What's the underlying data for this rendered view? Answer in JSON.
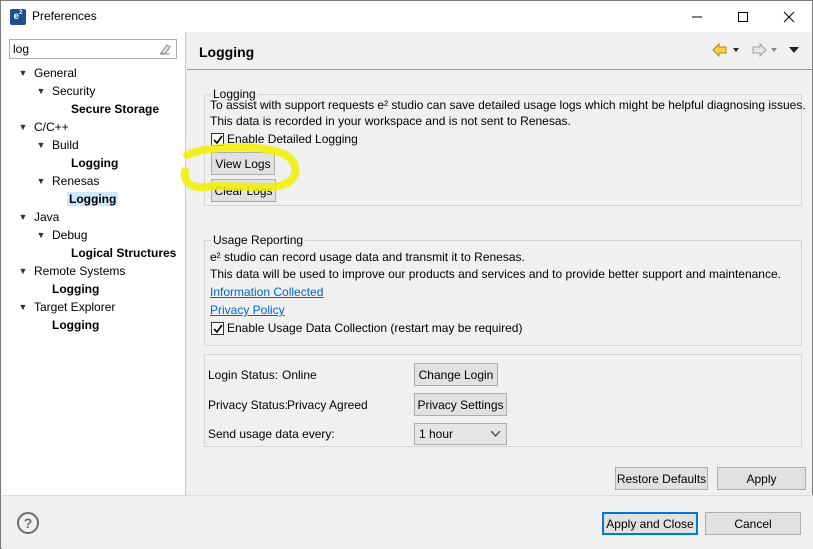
{
  "window": {
    "title": "Preferences",
    "app_icon": "e2-logo-icon"
  },
  "tree": {
    "filter_value": "log",
    "items": [
      {
        "label": "General"
      },
      {
        "label": "Security"
      },
      {
        "label": "Secure Storage"
      },
      {
        "label": "C/C++"
      },
      {
        "label": "Build"
      },
      {
        "label": "Logging"
      },
      {
        "label": "Renesas"
      },
      {
        "label": "Logging"
      },
      {
        "label": "Java"
      },
      {
        "label": "Debug"
      },
      {
        "label": "Logical Structures"
      },
      {
        "label": "Remote Systems"
      },
      {
        "label": "Logging"
      },
      {
        "label": "Target Explorer"
      },
      {
        "label": "Logging"
      }
    ]
  },
  "page": {
    "title": "Logging"
  },
  "logging_group": {
    "title": "Logging",
    "line1": "To assist with support requests e² studio can save detailed usage logs which might be helpful diagnosing issues.",
    "line2": "This data is recorded in your workspace and is not sent to Renesas.",
    "enable_label": "Enable Detailed Logging",
    "enable_checked": true,
    "view_logs_label": "View Logs",
    "clear_logs_label": "Clear Logs"
  },
  "usage_group": {
    "title": "Usage Reporting",
    "line1": "e² studio can record usage data and transmit it to Renesas.",
    "line2": "This data will be used to improve our products and services and to provide better support and maintenance.",
    "info_link": "Information Collected",
    "privacy_link": "Privacy Policy",
    "enable_label": "Enable Usage Data Collection (restart may be required)",
    "enable_checked": true
  },
  "status_group": {
    "login_label": "Login Status:",
    "login_value": "Online",
    "change_login_label": "Change Login",
    "privacy_label": "Privacy Status:",
    "privacy_value": "Privacy Agreed",
    "privacy_settings_label": "Privacy Settings",
    "send_label": "Send usage data every:",
    "send_value": "1 hour"
  },
  "buttons": {
    "restore_defaults": "Restore Defaults",
    "apply": "Apply",
    "apply_and_close": "Apply and Close",
    "cancel": "Cancel"
  },
  "colors": {
    "highlight": "#f0f000",
    "selection": "#cce8ff",
    "link": "#0066cc",
    "default_button_border": "#0078d7"
  }
}
